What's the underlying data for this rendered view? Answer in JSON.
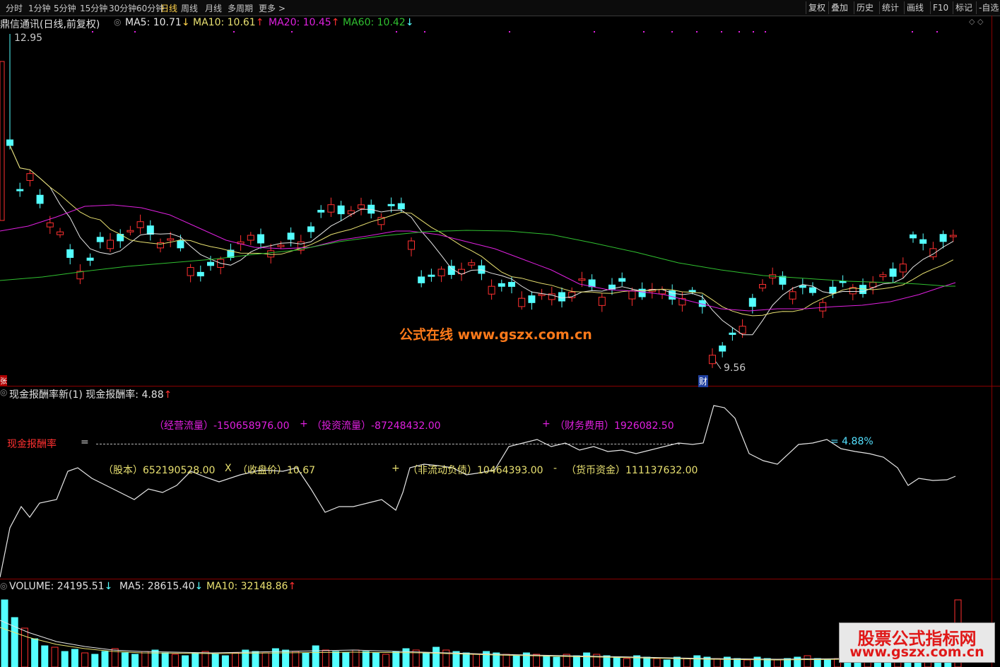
{
  "toolbar": {
    "periods": [
      "分时",
      "1分钟",
      "5分钟",
      "15分钟",
      "30分钟",
      "60分钟",
      "日线",
      "周线",
      "月线",
      "多周期",
      "更多 >"
    ],
    "active": "日线",
    "right": [
      "复权",
      "叠加",
      "历史",
      "统计",
      "画线",
      "F10",
      "标记",
      "-自选"
    ]
  },
  "price_panel": {
    "title": "鼎信通讯(日线,前复权)",
    "ma5": "MA5: 10.71",
    "ma5_arrow": "↓",
    "ma10": "MA10: 10.61",
    "ma10_arrow": "↑",
    "ma20": "MA20: 10.45",
    "ma20_arrow": "↑",
    "ma60": "MA60: 10.42",
    "ma60_arrow": "↓",
    "high_label": "12.95",
    "low_label": "9.56",
    "event_marker": "财",
    "left_marker": "张",
    "overlay_watermark": "公式在线  www.gszx.com.cn",
    "colors": {
      "ma5": "#e6e6e6",
      "ma10": "#e8e070",
      "ma20": "#e020e0",
      "ma60": "#30c030",
      "up": "#ff3030",
      "down": "#54ffff"
    }
  },
  "indicator_panel": {
    "title": "现金报酬率新(1) 现金报酬率: 4.88",
    "arrow": "↑",
    "formula": {
      "op_cashflow": "（经营流量）-150658976.00",
      "plus1": "+",
      "inv_cashflow": "（投资流量）-87248432.00",
      "plus2": "+",
      "fin_cost": "（财务费用）1926082.50",
      "name": "现金报酬率",
      "equals": "=",
      "result": "= 4.88%",
      "shares": "（股本）652190528.00",
      "times": "X",
      "close": "（收盘价）10.67",
      "plus3": "+",
      "noncurrent": "（非流动负债）10464393.00",
      "minus": "-",
      "cash": "（货币资金）111137632.00"
    }
  },
  "volume_panel": {
    "volume": "VOLUME: 24195.51",
    "volume_arrow": "↓",
    "ma5": "MA5: 28615.40",
    "ma5_arrow": "↓",
    "ma10": "MA10: 32148.86",
    "ma10_arrow": "↑"
  },
  "watermark": {
    "line1": "股票公式指标网",
    "line2": "www.gszx.com.cn"
  }
}
